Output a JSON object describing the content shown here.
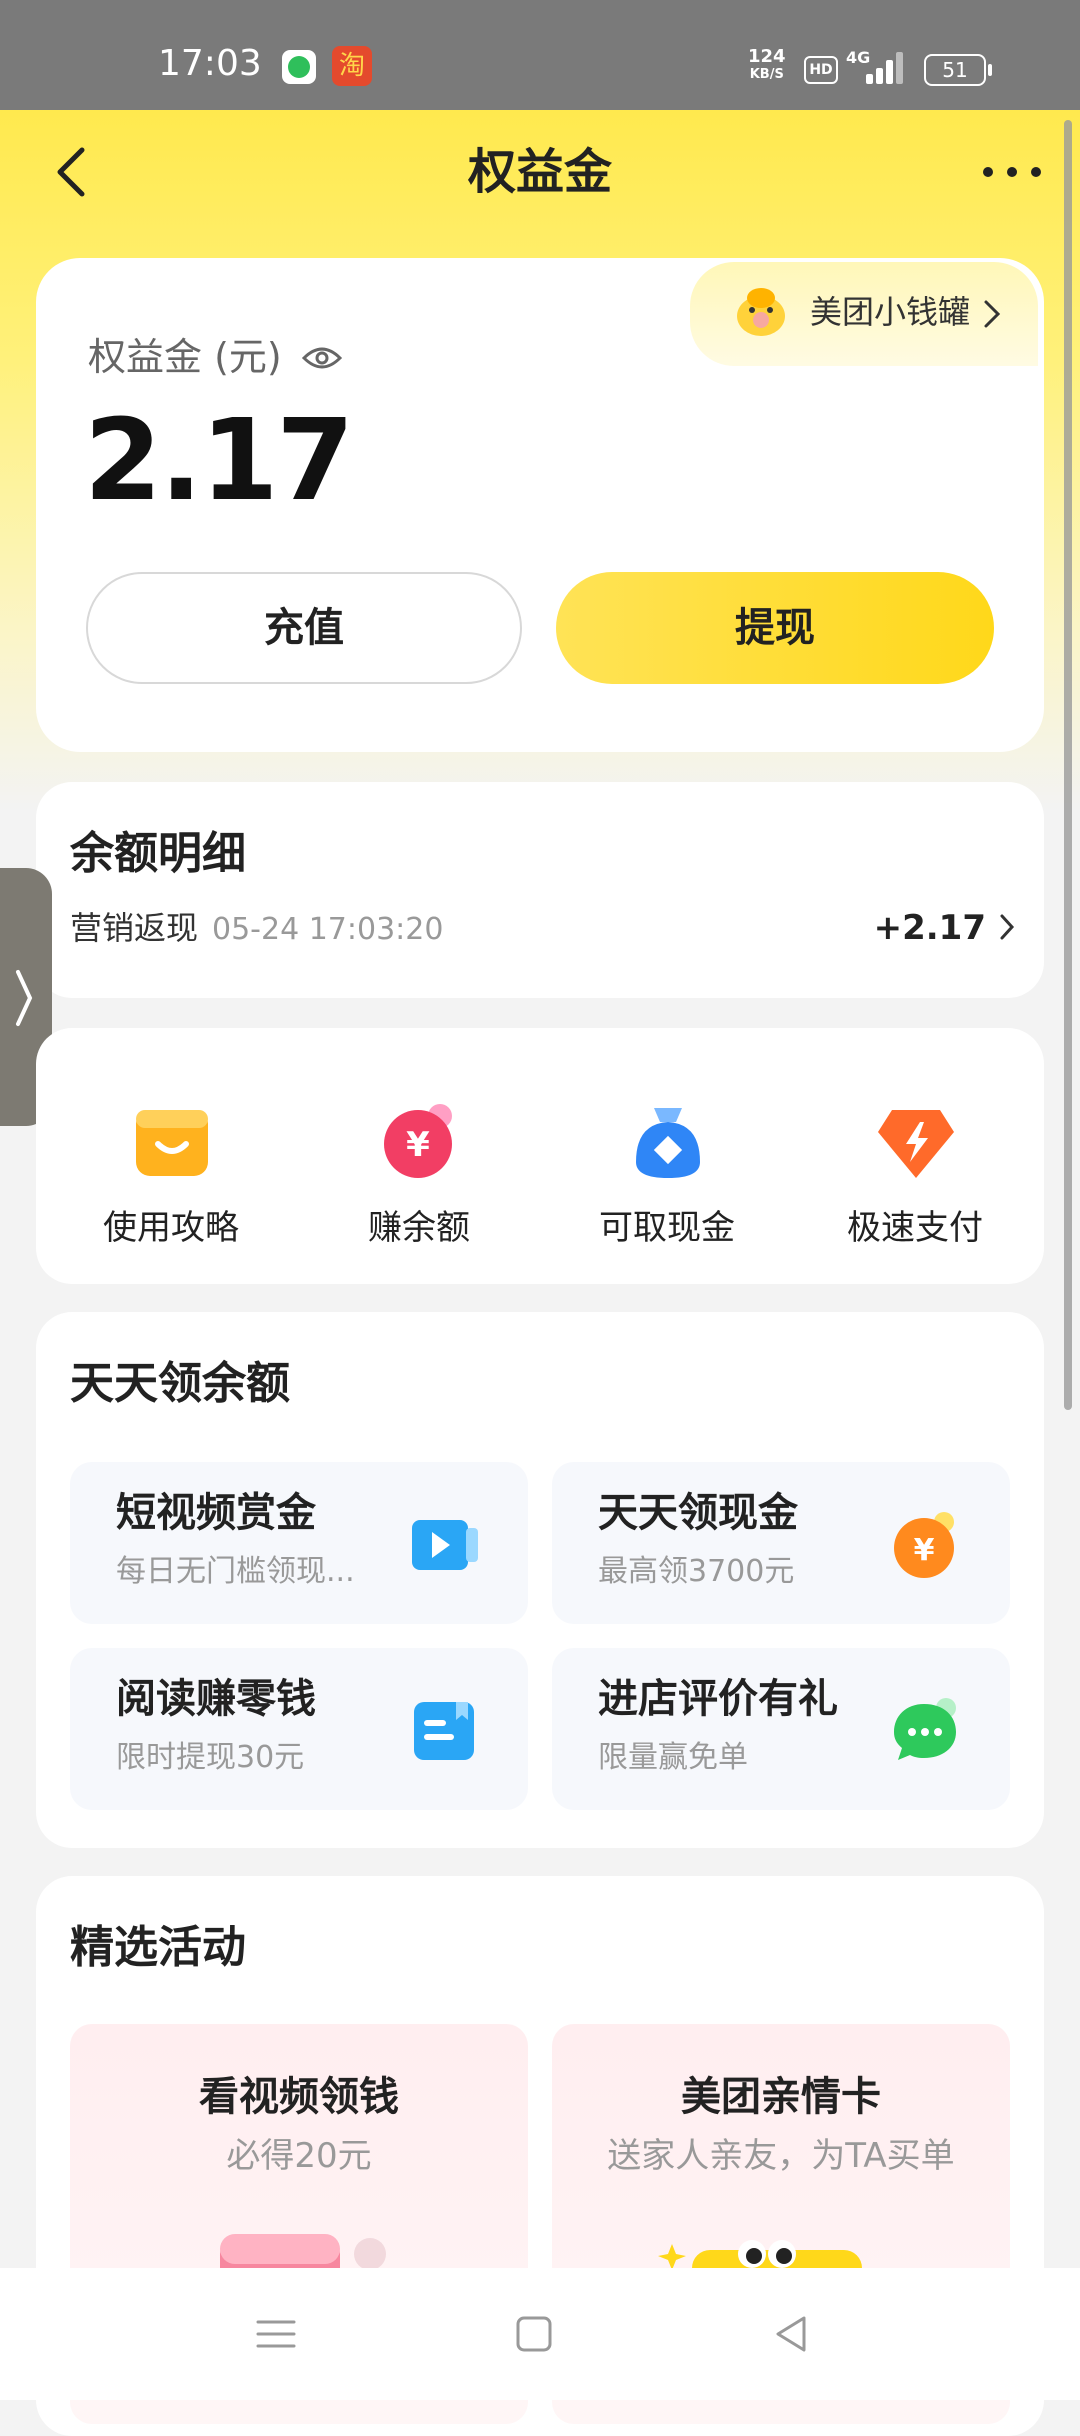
{
  "status_bar": {
    "time": "17:03",
    "net_speed_value": "124",
    "net_speed_unit": "KB/S",
    "hd": "HD",
    "network": "4G",
    "battery": "51"
  },
  "header": {
    "title": "权益金"
  },
  "piggy": {
    "label": "美团小钱罐"
  },
  "balance": {
    "label": "权益金 (元)",
    "amount": "2.17",
    "recharge_label": "充值",
    "withdraw_label": "提现"
  },
  "detail": {
    "title": "余额明细",
    "type": "营销返现",
    "time": "05-24 17:03:20",
    "amount": "+2.17"
  },
  "quick_actions": [
    {
      "label": "使用攻略",
      "icon": "wallet-smile-icon"
    },
    {
      "label": "赚余额",
      "icon": "yuan-coin-icon"
    },
    {
      "label": "可取现金",
      "icon": "money-bag-icon"
    },
    {
      "label": "极速支付",
      "icon": "lightning-gem-icon"
    }
  ],
  "daily": {
    "title": "天天领余额",
    "tasks": [
      {
        "title": "短视频赏金",
        "subtitle": "每日无门槛领现...",
        "icon": "video-play-icon"
      },
      {
        "title": "天天领现金",
        "subtitle": "最高领3700元",
        "icon": "yuan-coin-icon"
      },
      {
        "title": "阅读赚零钱",
        "subtitle": "限时提现30元",
        "icon": "book-icon"
      },
      {
        "title": "进店评价有礼",
        "subtitle": "限量赢免单",
        "icon": "chat-bubble-icon"
      }
    ]
  },
  "activities": {
    "title": "精选活动",
    "items": [
      {
        "title": "看视频领钱",
        "subtitle": "必得20元"
      },
      {
        "title": "美团亲情卡",
        "subtitle": "送家人亲友，为TA买单"
      }
    ]
  },
  "colors": {
    "brand_yellow": "#ffd81a",
    "status_bar": "#7a7a7a",
    "background": "#f3f3f3"
  }
}
